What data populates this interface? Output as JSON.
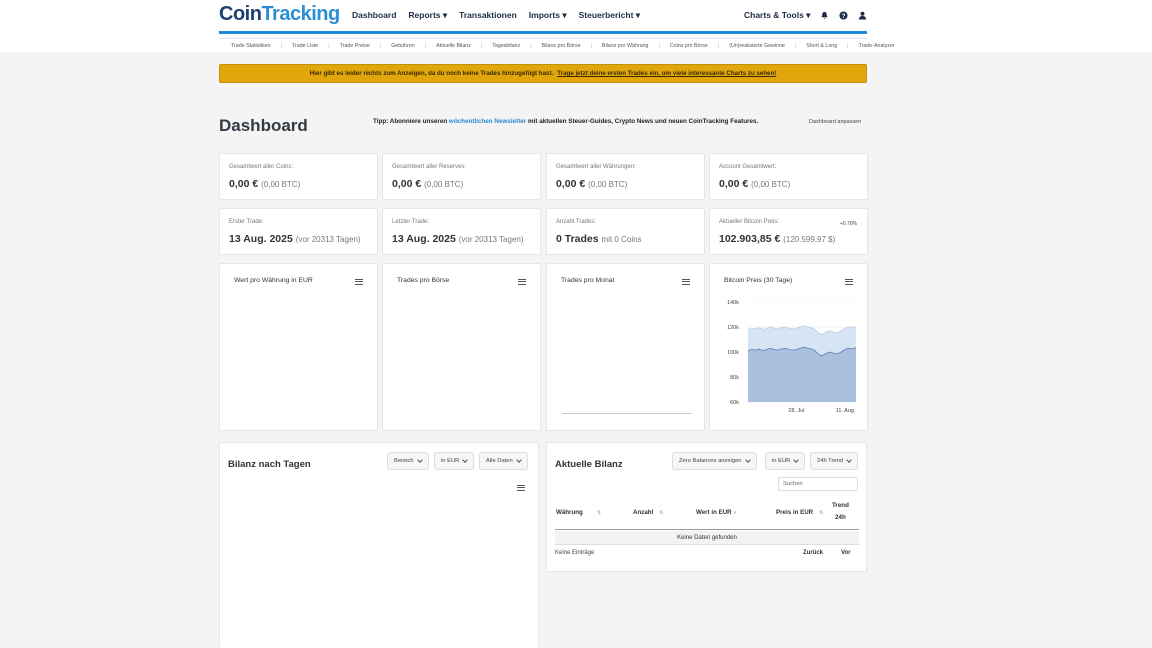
{
  "brand": {
    "part1": "Coin",
    "part2": "Tracking"
  },
  "nav": {
    "items": [
      "Dashboard",
      "Reports ▾",
      "Transaktionen",
      "Imports ▾",
      "Steuerbericht ▾"
    ],
    "right": "Charts & Tools ▾"
  },
  "subnav": [
    "Trade Statistiken",
    "Trade Liste",
    "Trade Preise",
    "Gebühren",
    "Aktuelle Bilanz",
    "Tagesbilanz",
    "Bilanz pro Börse",
    "Bilanz pro Währung",
    "Coins pro Börse",
    "(Un)realisierte Gewinne",
    "Short & Long",
    "Trade-Analyzer"
  ],
  "banner": {
    "text": "Hier gibt es leider nichts zum Anzeigen, da du noch keine Trades hinzugefügt hast.",
    "link": "Trage jetzt deine ersten Trades ein, um viele interessante Charts zu sehen!"
  },
  "dashboard": {
    "title": "Dashboard",
    "tip_prefix": "Tipp: Abonniere unseren",
    "tip_link": "wöchentlichen Newsletter",
    "tip_suffix": "mit aktuellen Steuer-Guides, Crypto News und neuen CoinTracking Features.",
    "adjust": "Dashboard anpassen"
  },
  "stats_row1": [
    {
      "label": "Gesamtwert aller Coins:",
      "value": "0,00 €",
      "sub": "(0,00 BTC)"
    },
    {
      "label": "Gesamtwert aller Reserves:",
      "value": "0,00 €",
      "sub": "(0,00 BTC)"
    },
    {
      "label": "Gesamtwert aller Währungen:",
      "value": "0,00 €",
      "sub": "(0,00 BTC)"
    },
    {
      "label": "Account Gesamtwert:",
      "value": "0,00 €",
      "sub": "(0,00 BTC)"
    }
  ],
  "stats_row2": [
    {
      "label": "Erster Trade:",
      "value": "13 Aug. 2025",
      "sub": "(vor 20313 Tagen)"
    },
    {
      "label": "Letzter Trade:",
      "value": "13 Aug. 2025",
      "sub": "(vor 20313 Tagen)"
    },
    {
      "label": "Anzahl Trades:",
      "value": "0 Trades",
      "sub": "mit 0 Coins"
    },
    {
      "label": "Aktueller Bitcoin Preis:",
      "value": "102.903,85 €",
      "sub": "(120.599,97 $)",
      "badge": "+0.70%"
    }
  ],
  "charts": [
    {
      "title": "Wert pro Währung in EUR"
    },
    {
      "title": "Trades pro Börse"
    },
    {
      "title": "Trades pro Monat"
    },
    {
      "title": "Bitcoin Preis (30 Tage)"
    }
  ],
  "btc_chart": {
    "y_ticks": [
      "140k",
      "120k",
      "100k",
      "80k",
      "60k"
    ],
    "x_ticks": [
      "28. Jul",
      "11. Aug"
    ]
  },
  "chart_data": {
    "type": "area",
    "title": "Bitcoin Preis (30 Tage)",
    "xlabel": "",
    "ylabel": "",
    "ylim": [
      60000,
      140000
    ],
    "x_ticks": [
      "28. Jul",
      "11. Aug"
    ],
    "series": [
      {
        "values": [
          101000,
          102000,
          101500,
          102500,
          101000,
          102000,
          103000,
          102000,
          101500,
          102500,
          103000,
          102000,
          101500,
          102000,
          103000,
          104000,
          103000,
          102500,
          101000,
          98000,
          97000,
          99000,
          100000,
          99000,
          98500,
          100000,
          102000,
          103000,
          102500,
          103500
        ]
      },
      {
        "values": [
          118000,
          119000,
          118500,
          119500,
          118000,
          119000,
          120000,
          119000,
          118500,
          119500,
          120000,
          119000,
          118500,
          119000,
          120000,
          121000,
          120000,
          119500,
          118000,
          115000,
          114000,
          116000,
          117000,
          116000,
          115500,
          117000,
          119000,
          120000,
          119500,
          120500
        ]
      }
    ],
    "grid": true
  },
  "balance_days": {
    "title": "Bilanz nach Tagen",
    "dropdowns": [
      "Bereich",
      "in EUR",
      "Alle Daten"
    ]
  },
  "current_balance": {
    "title": "Aktuelle Bilanz",
    "dropdowns": [
      "Zero Balances anzeigen",
      "in EUR",
      "24h Trend"
    ],
    "search_placeholder": "Suchen",
    "columns": [
      "Währung",
      "Anzahl",
      "Wert in EUR",
      "Preis in EUR",
      "Trend",
      "24h"
    ],
    "no_data": "Keine Daten gefunden",
    "entries": "Keine Einträge",
    "prev": "Zurück",
    "next": "Vor"
  },
  "colors": {
    "brand_blue": "#1e88d9",
    "banner": "#e1a60b",
    "area_dark": "#a9c1df",
    "area_light": "#d6e4f4"
  }
}
